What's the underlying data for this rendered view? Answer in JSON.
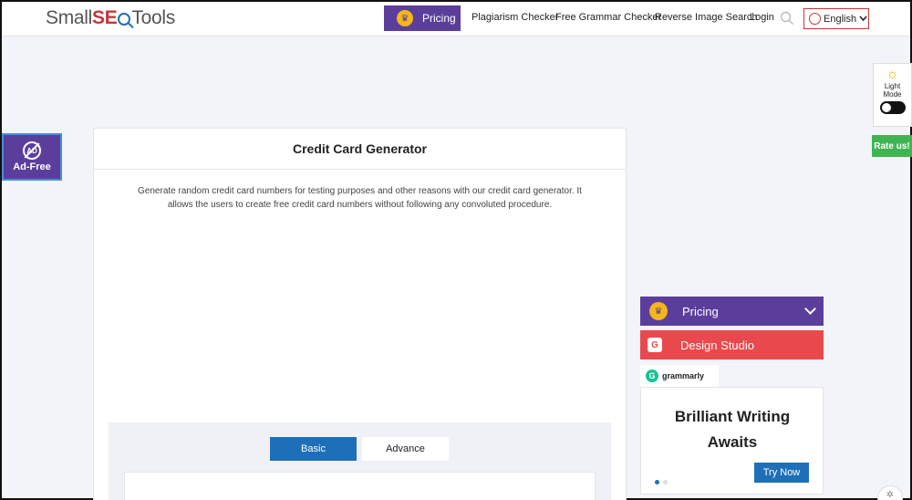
{
  "header": {
    "logo_prefix": "Small",
    "logo_seo": "SE",
    "logo_suffix": "Tools",
    "pricing_label": "Pricing",
    "nav": [
      {
        "label": "Plagiarism Checker"
      },
      {
        "label": "Free Grammar Checker"
      },
      {
        "label": "Reverse Image Search"
      },
      {
        "label": "Login"
      }
    ],
    "language": "English"
  },
  "adfree": {
    "badge": "AD",
    "label": "Ad-Free"
  },
  "theme": {
    "label_line1": "Light",
    "label_line2": "Mode"
  },
  "rate_us": "Rate us!",
  "main": {
    "title": "Credit Card Generator",
    "description": "Generate random credit card numbers for testing purposes and other reasons with our credit card generator. It allows the users to create free credit card numbers without following any convoluted procedure.",
    "tabs": [
      {
        "label": "Basic",
        "active": true
      },
      {
        "label": "Advance",
        "active": false
      }
    ]
  },
  "sidebar": {
    "pricing_label": "Pricing",
    "design_label": "Design Studio",
    "design_icon_letter": "G",
    "grammarly_label": "grammarly",
    "grammarly_icon_letter": "G",
    "ad_headline_line1": "Brilliant Writing",
    "ad_headline_line2": "Awaits",
    "ad_cta": "Try Now"
  },
  "colors": {
    "brand_purple": "#5b3e9c",
    "accent_blue": "#1e6fb8",
    "design_red": "#e9494d",
    "rate_green": "#3fb552",
    "crown_gold": "#f4b619"
  }
}
